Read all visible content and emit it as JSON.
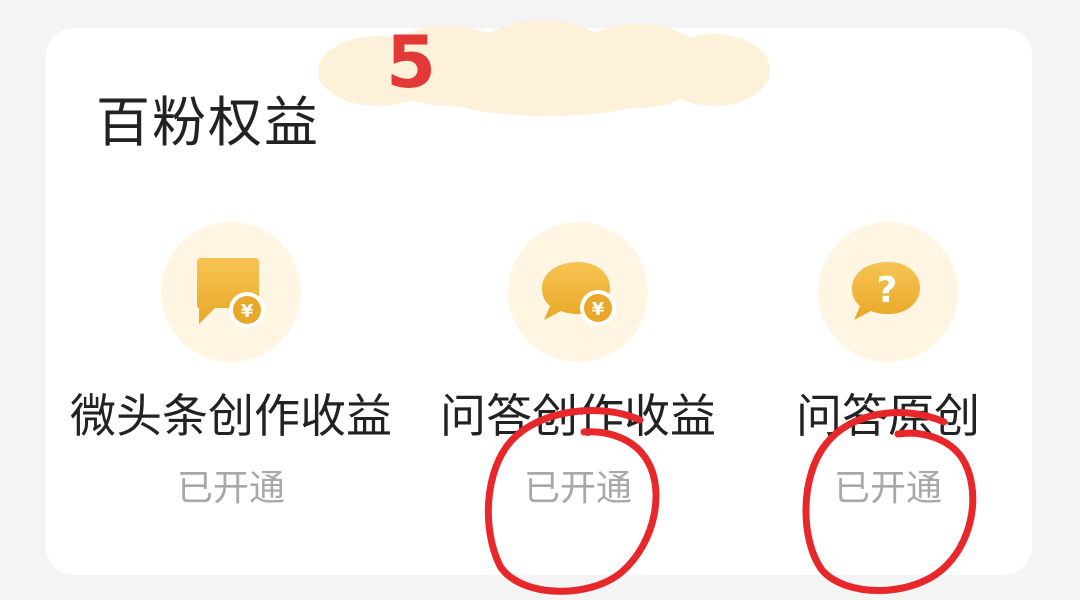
{
  "section_title": "百粉权益",
  "annotation_number": "5",
  "benefits": [
    {
      "name": "微头条创作收益",
      "status": "已开通",
      "icon": "comment-coin-icon"
    },
    {
      "name": "问答创作收益",
      "status": "已开通",
      "icon": "bubble-coin-icon"
    },
    {
      "name": "问答原创",
      "status": "已开通",
      "icon": "question-bubble-icon"
    }
  ],
  "colors": {
    "card_background": "#ffffff",
    "page_background": "#f4f4f5",
    "icon_circle": "#fef6e3",
    "icon_gold": "#f0b83a",
    "status_gray": "#a8a8a8",
    "annotation_red": "#e23838"
  }
}
